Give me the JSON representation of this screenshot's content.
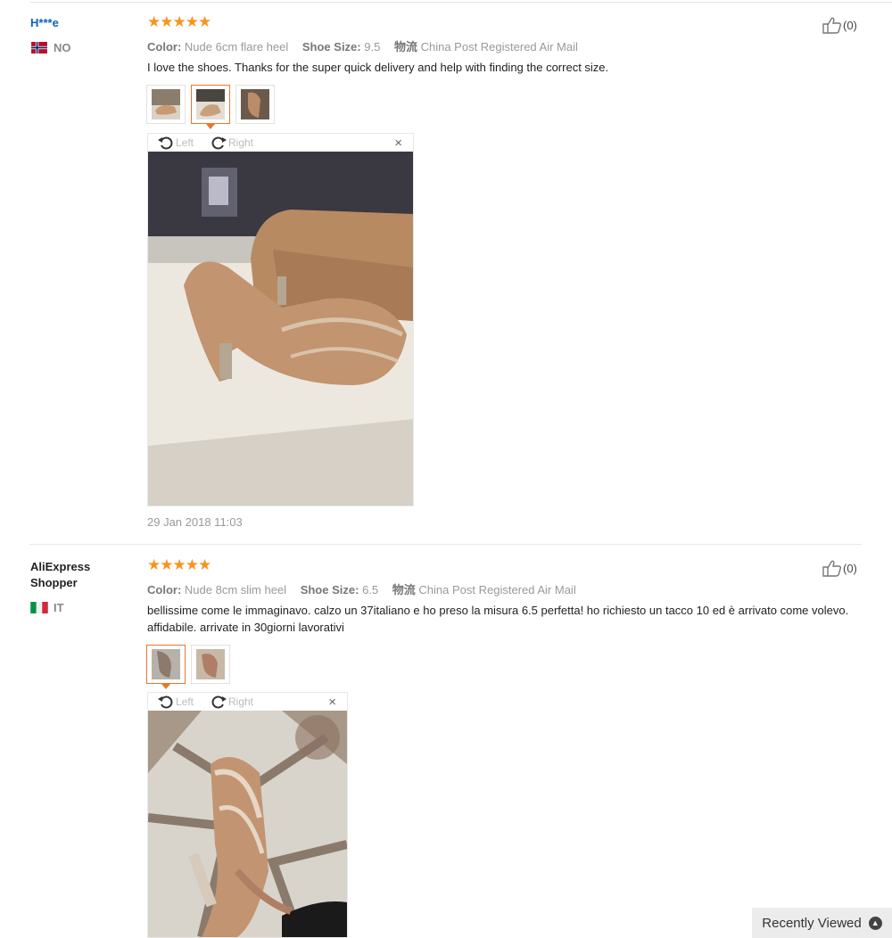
{
  "reviews": [
    {
      "user": "H***e",
      "country": "NO",
      "stars": "★★★★★",
      "color_label": "Color:",
      "color_value": "Nude 6cm flare heel",
      "size_label": "Shoe Size:",
      "size_value": "9.5",
      "ship_label": "物流",
      "ship_value": "China Post Registered Air Mail",
      "text": "I love the shoes. Thanks for the super quick delivery and help with finding the correct size.",
      "date": "29 Jan 2018 11:03",
      "likes": "(0)",
      "rotate_left": "Left",
      "rotate_right": "Right",
      "close": "×"
    },
    {
      "user": "AliExpress Shopper",
      "country": "IT",
      "stars": "★★★★★",
      "color_label": "Color:",
      "color_value": "Nude 8cm slim heel",
      "size_label": "Shoe Size:",
      "size_value": "6.5",
      "ship_label": "物流",
      "ship_value": "China Post Registered Air Mail",
      "text": "bellissime come le immaginavo. calzo un 37italiano e ho preso la misura 6.5 perfetta! ho richiesto un tacco 10 ed è arrivato come volevo. affidabile. arrivate in 30giorni lavorativi",
      "likes": "(0)",
      "rotate_left": "Left",
      "rotate_right": "Right",
      "close": "×"
    }
  ],
  "recently_viewed": "Recently Viewed",
  "colors": {
    "star": "#f7941d",
    "link": "#0f62c0",
    "selected_border": "#e8772e"
  },
  "icons": [
    "thumbs-up-icon",
    "rotate-left-icon",
    "rotate-right-icon",
    "close-icon",
    "chevron-up-icon",
    "flag-norway-icon",
    "flag-italy-icon"
  ]
}
